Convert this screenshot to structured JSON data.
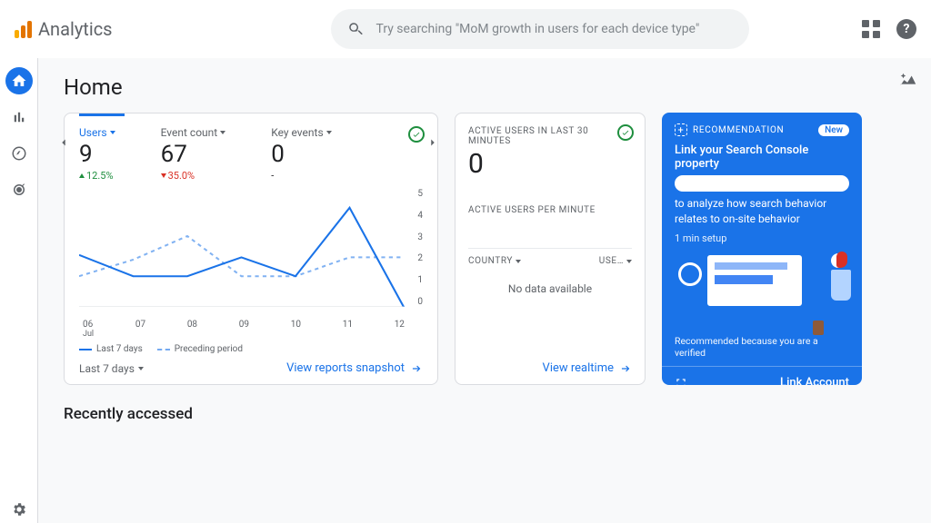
{
  "header": {
    "app_name": "Analytics",
    "search_placeholder": "Try searching \"MoM growth in users for each device type\""
  },
  "page": {
    "title": "Home",
    "recently_accessed": "Recently accessed"
  },
  "overview_card": {
    "metrics": [
      {
        "label": "Users",
        "value": "9",
        "delta": "12.5%",
        "direction": "up"
      },
      {
        "label": "Event count",
        "value": "67",
        "delta": "35.0%",
        "direction": "down"
      },
      {
        "label": "Key events",
        "value": "0",
        "delta": "-",
        "direction": "none"
      }
    ],
    "legend": {
      "solid": "Last 7 days",
      "dashed": "Preceding period"
    },
    "range": "Last 7 days",
    "action": "View reports snapshot"
  },
  "chart_data": {
    "type": "line",
    "x_labels": [
      "06",
      "07",
      "08",
      "09",
      "10",
      "11",
      "12"
    ],
    "x_sub": "Jul",
    "ylim": [
      0,
      5
    ],
    "y_ticks": [
      5,
      4,
      3,
      2,
      1,
      0
    ],
    "series": [
      {
        "name": "Last 7 days",
        "style": "solid",
        "values": [
          2.2,
          1.3,
          1.3,
          2.1,
          1.3,
          4.2,
          0
        ]
      },
      {
        "name": "Preceding period",
        "style": "dashed",
        "values": [
          1.3,
          2.0,
          3.0,
          1.3,
          1.3,
          2.1,
          2.1
        ]
      }
    ]
  },
  "realtime_card": {
    "label": "ACTIVE USERS IN LAST 30 MINUTES",
    "value": "0",
    "sub": "ACTIVE USERS PER MINUTE",
    "columns": {
      "left": "COUNTRY",
      "right": "USE…"
    },
    "nodata": "No data available",
    "action": "View realtime"
  },
  "reco_card": {
    "badge": "RECOMMENDATION",
    "new": "New",
    "title": "Link your Search Console property",
    "desc": "to analyze how search behavior relates to on-site behavior",
    "time": "1 min setup",
    "because": "Recommended because you are a verified",
    "action": "Link Account"
  }
}
